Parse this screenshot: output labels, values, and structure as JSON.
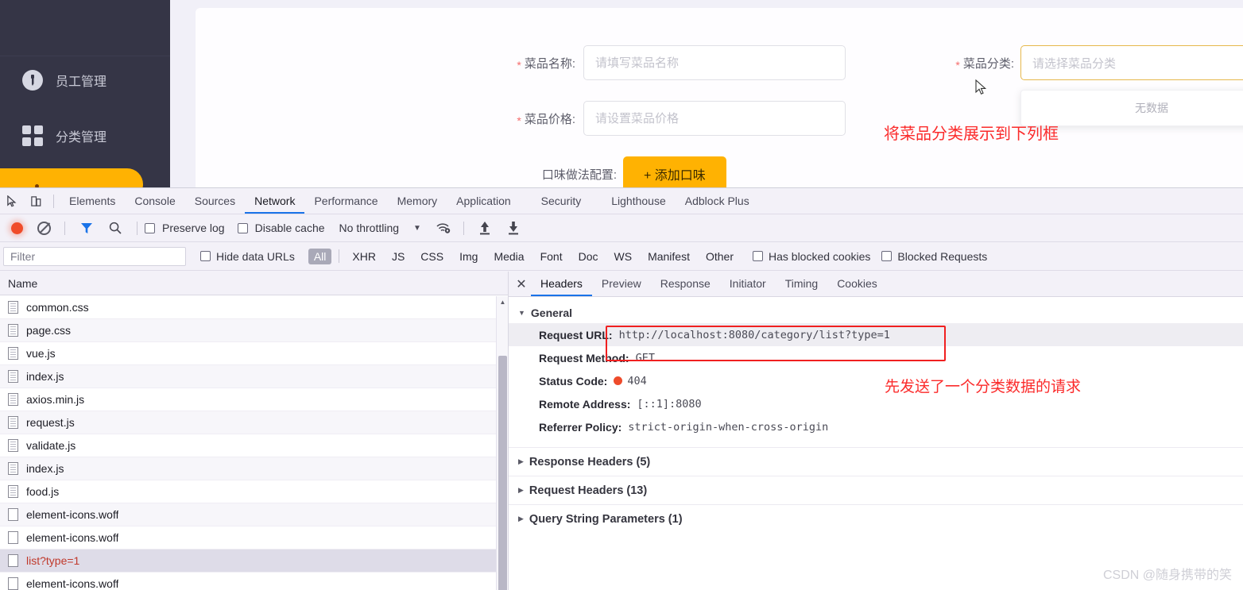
{
  "app": {
    "sidebar": {
      "items": [
        {
          "label": "员工管理",
          "icon": "employee-icon"
        },
        {
          "label": "分类管理",
          "icon": "category-grid-icon"
        }
      ]
    },
    "form": {
      "name": {
        "label": "菜品名称:",
        "placeholder": "请填写菜品名称",
        "value": "",
        "required": true
      },
      "price": {
        "label": "菜品价格:",
        "placeholder": "请设置菜品价格",
        "value": "",
        "required": true
      },
      "flavor": {
        "label": "口味做法配置:",
        "button": "+ 添加口味"
      },
      "category": {
        "label": "菜品分类:",
        "placeholder": "请选择菜品分类",
        "value": "",
        "required": true,
        "dropdown_empty": "无数据",
        "arrow": "chevron-up-icon"
      }
    },
    "annotations": {
      "category": "将菜品分类展示到下列框",
      "request": "先发送了一个分类数据的请求"
    }
  },
  "devtools": {
    "tabs": [
      {
        "label": "Elements",
        "active": false
      },
      {
        "label": "Console",
        "active": false
      },
      {
        "label": "Sources",
        "active": false
      },
      {
        "label": "Network",
        "active": true
      },
      {
        "label": "Performance",
        "active": false
      },
      {
        "label": "Memory",
        "active": false
      },
      {
        "label": "Application",
        "active": false
      },
      {
        "label": "Security",
        "active": false
      },
      {
        "label": "Lighthouse",
        "active": false
      },
      {
        "label": "Adblock Plus",
        "active": false
      }
    ],
    "toolbar": {
      "record": "record-button",
      "clear": "clear-button",
      "filter": "funnel-icon",
      "search": "search-icon",
      "preserve_log": "Preserve log",
      "disable_cache": "Disable cache",
      "throttling": "No throttling",
      "import_har": "import-har-icon",
      "export_har": "export-har-icon"
    },
    "filterbar": {
      "placeholder": "Filter",
      "value": "",
      "hide_data_urls": "Hide data URLs",
      "types": [
        "All",
        "XHR",
        "JS",
        "CSS",
        "Img",
        "Media",
        "Font",
        "Doc",
        "WS",
        "Manifest",
        "Other"
      ],
      "selected_type": "All",
      "has_blocked_cookies": "Has blocked cookies",
      "blocked_requests": "Blocked Requests"
    },
    "requests": {
      "column_header": "Name",
      "rows": [
        {
          "name": "common.css",
          "type": "doc",
          "selected": false
        },
        {
          "name": "page.css",
          "type": "doc",
          "selected": false
        },
        {
          "name": "vue.js",
          "type": "doc",
          "selected": false
        },
        {
          "name": "index.js",
          "type": "doc",
          "selected": false
        },
        {
          "name": "axios.min.js",
          "type": "doc",
          "selected": false
        },
        {
          "name": "request.js",
          "type": "doc",
          "selected": false
        },
        {
          "name": "validate.js",
          "type": "doc",
          "selected": false
        },
        {
          "name": "index.js",
          "type": "doc",
          "selected": false
        },
        {
          "name": "food.js",
          "type": "doc",
          "selected": false
        },
        {
          "name": "element-icons.woff",
          "type": "font",
          "selected": false
        },
        {
          "name": "element-icons.woff",
          "type": "font",
          "selected": false
        },
        {
          "name": "list?type=1",
          "type": "font",
          "selected": true
        },
        {
          "name": "element-icons.woff",
          "type": "font",
          "selected": false
        }
      ]
    },
    "details": {
      "tabs": [
        {
          "label": "Headers",
          "active": true
        },
        {
          "label": "Preview",
          "active": false
        },
        {
          "label": "Response",
          "active": false
        },
        {
          "label": "Initiator",
          "active": false
        },
        {
          "label": "Timing",
          "active": false
        },
        {
          "label": "Cookies",
          "active": false
        }
      ],
      "general_title": "General",
      "general": [
        {
          "key": "Request URL:",
          "value": "http://localhost:8080/category/list?type=1",
          "highlight": true
        },
        {
          "key": "Request Method:",
          "value": "GET",
          "highlight": false
        },
        {
          "key": "Status Code:",
          "value": "404",
          "highlight": false,
          "status_dot": true
        },
        {
          "key": "Remote Address:",
          "value": "[::1]:8080",
          "highlight": false
        },
        {
          "key": "Referrer Policy:",
          "value": "strict-origin-when-cross-origin",
          "highlight": false
        }
      ],
      "collapsed_sections": [
        "Response Headers (5)",
        "Request Headers (13)",
        "Query String Parameters (1)"
      ]
    }
  },
  "watermark": "CSDN @随身携带的笑",
  "colors": {
    "sidebar_bg": "#353546",
    "accent_orange": "#ffb202",
    "annotation_red": "#fb2b2b",
    "devtools_active": "#1a73e8",
    "status_error": "#ee4b2b"
  }
}
